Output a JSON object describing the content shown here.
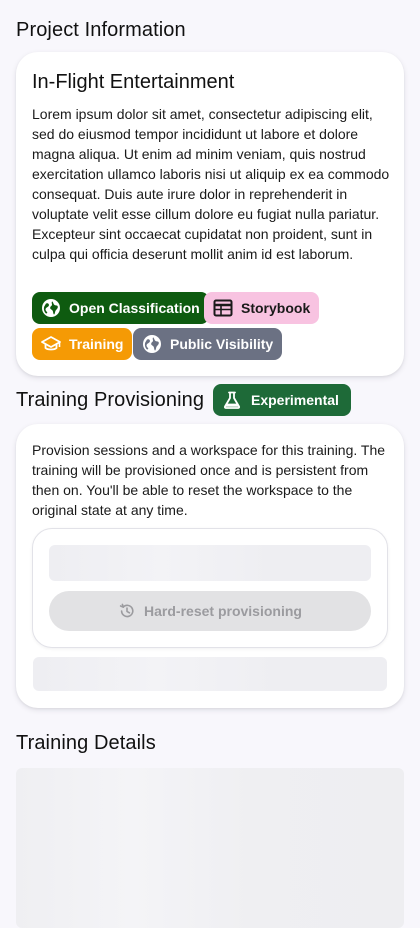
{
  "project_information": {
    "heading": "Project Information",
    "card_title": "In-Flight Entertainment",
    "description": "Lorem ipsum dolor sit amet, consectetur adipiscing elit, sed do eiusmod tempor incididunt ut labore et dolore magna aliqua. Ut enim ad minim veniam, quis nostrud exercitation ullamco laboris nisi ut aliquip ex ea commodo consequat. Duis aute irure dolor in reprehenderit in voluptate velit esse cillum dolore eu fugiat nulla pariatur. Excepteur sint occaecat cupidatat non proident, sunt in culpa qui officia deserunt mollit anim id est laborum.",
    "chips": [
      {
        "label": "Open Classification",
        "icon": "globe-icon",
        "color": "#0e5b10"
      },
      {
        "label": "Storybook",
        "icon": "table-icon",
        "color": "#f8c3e1"
      },
      {
        "label": "Training",
        "icon": "graduation-cap-icon",
        "color": "#f59a05"
      },
      {
        "label": "Public Visibility",
        "icon": "globe-icon",
        "color": "#6b7183"
      }
    ]
  },
  "training_provisioning": {
    "heading": "Training Provisioning",
    "badge": {
      "label": "Experimental",
      "icon": "flask-icon",
      "color": "#1e6a38"
    },
    "description": "Provision sessions and a workspace for this training. The training will be provisioned once and is persistent from then on. You'll be able to reset the workspace to the original state at any time.",
    "reset_button": {
      "label": "Hard-reset provisioning",
      "icon": "history-icon",
      "disabled": true
    }
  },
  "training_details": {
    "heading": "Training Details"
  }
}
